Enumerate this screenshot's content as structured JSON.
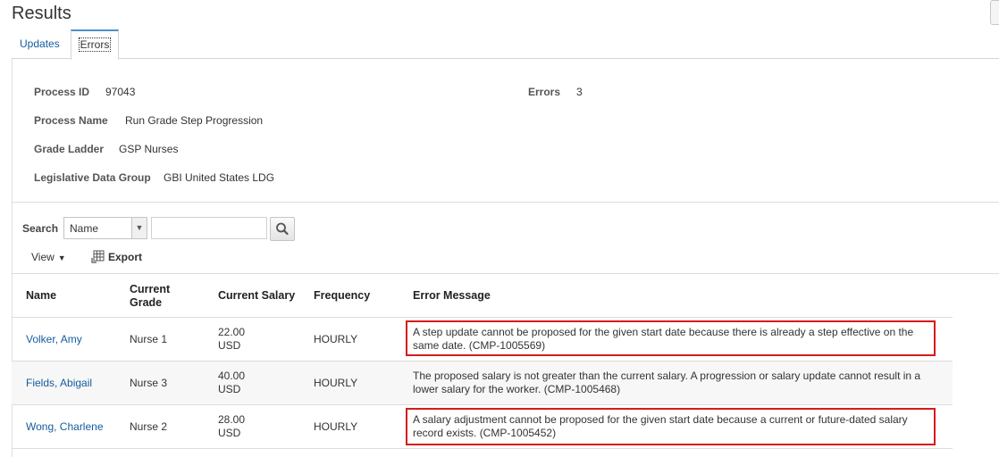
{
  "page": {
    "title": "Results"
  },
  "tabs": [
    {
      "label": "Updates"
    },
    {
      "label": "Errors"
    }
  ],
  "process": {
    "process_id_label": "Process ID",
    "process_id": "97043",
    "process_name_label": "Process Name",
    "process_name": "Run Grade Step Progression",
    "grade_ladder_label": "Grade Ladder",
    "grade_ladder": "GSP Nurses",
    "ldg_label": "Legislative Data Group",
    "ldg": "GBI United States LDG",
    "errors_label": "Errors",
    "errors": "3"
  },
  "search": {
    "label": "Search",
    "field": "Name",
    "value": "",
    "icon": "magnifier-icon"
  },
  "toolbar": {
    "view_label": "View",
    "export_label": "Export"
  },
  "table": {
    "headers": {
      "name": "Name",
      "grade_line1": "Current",
      "grade_line2": "Grade",
      "salary": "Current Salary",
      "frequency": "Frequency",
      "message": "Error Message"
    },
    "rows": [
      {
        "name": "Volker, Amy",
        "grade": "Nurse 1",
        "salary_amount": "22.00",
        "salary_currency": "USD",
        "frequency": "HOURLY",
        "highlighted": true,
        "message_line1": "A step update cannot be proposed for the given start date because there is already a step effective on the",
        "message_line2": "same date. (CMP-1005569)"
      },
      {
        "name": "Fields, Abigail",
        "grade": "Nurse 3",
        "salary_amount": "40.00",
        "salary_currency": "USD",
        "frequency": "HOURLY",
        "highlighted": false,
        "message_line1": "The proposed salary is not greater than the current salary. A progression or salary update cannot result in a",
        "message_line2": "lower salary for the worker. (CMP-1005468)"
      },
      {
        "name": "Wong, Charlene",
        "grade": "Nurse 2",
        "salary_amount": "28.00",
        "salary_currency": "USD",
        "frequency": "HOURLY",
        "highlighted": true,
        "message_line1": "A salary adjustment cannot be proposed for the given start date because a current or future-dated salary",
        "message_line2": "record exists. (CMP-1005452)"
      }
    ]
  },
  "colors": {
    "link": "#145c9e",
    "highlight_border": "#d61b1b",
    "tab_accent": "#4a90c8"
  }
}
